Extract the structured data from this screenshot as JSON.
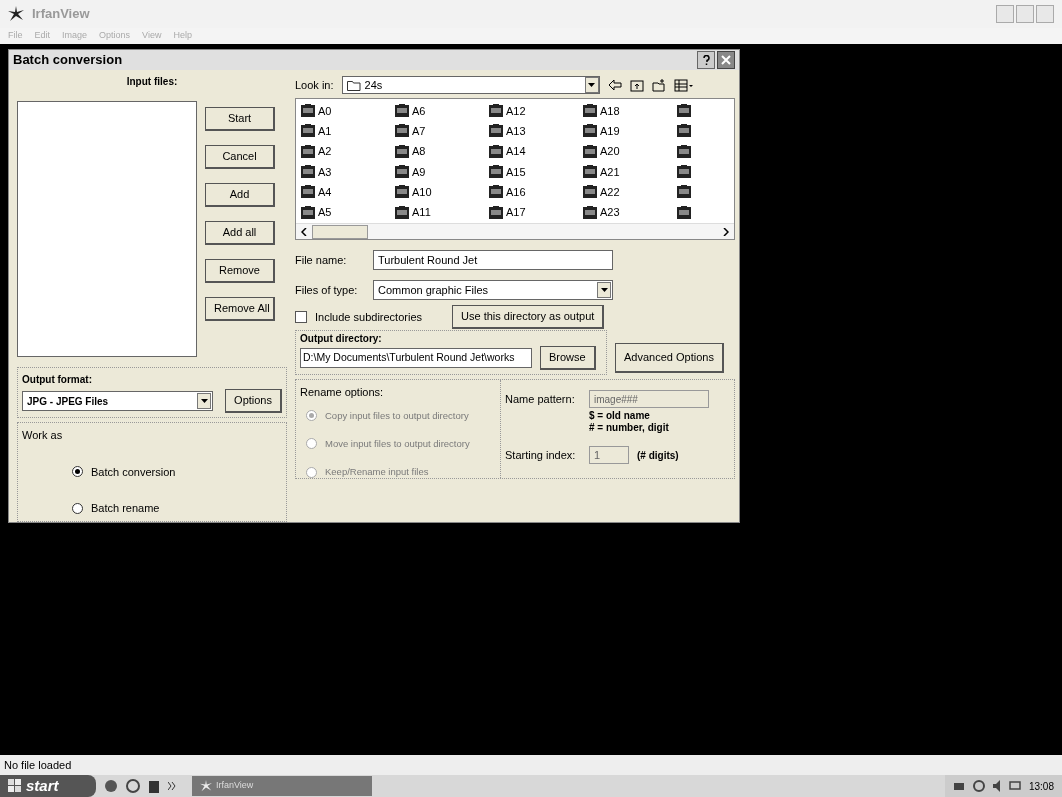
{
  "app": {
    "title": "IrfanView",
    "menu": [
      "File",
      "Edit",
      "Image",
      "Options",
      "View",
      "Help"
    ]
  },
  "dialog": {
    "title": "Batch conversion",
    "input_files": {
      "label": "Input files:"
    },
    "buttons": [
      "Start",
      "Cancel",
      "Add",
      "Add all",
      "Remove",
      "Remove All"
    ],
    "look_in": {
      "label": "Look in:",
      "value": "24s"
    },
    "files": [
      "A0",
      "A1",
      "A2",
      "A3",
      "A4",
      "A5",
      "A6",
      "A7",
      "A8",
      "A9",
      "A10",
      "A11",
      "A12",
      "A13",
      "A14",
      "A15",
      "A16",
      "A17",
      "A18",
      "A19",
      "A20",
      "A21",
      "A22",
      "A23"
    ],
    "file_name": {
      "label": "File name:",
      "value": "Turbulent Round Jet"
    },
    "files_of_type": {
      "label": "Files of type:",
      "value": "Common graphic Files"
    },
    "include_subdirectories": {
      "label": "Include subdirectories",
      "checked": false
    },
    "use_dir_button": "Use this directory as output",
    "output_format": {
      "label": "Output format:",
      "value": "JPG - JPEG Files",
      "button": "Options"
    },
    "output_directory": {
      "label": "Output directory:",
      "value": "D:\\My Documents\\Turbulent Round Jet\\works",
      "button": "Browse"
    },
    "advanced_button": "Advanced Options",
    "work_as": {
      "label": "Work as",
      "options": [
        {
          "label": "Batch conversion",
          "selected": true
        },
        {
          "label": "Batch rename",
          "selected": false
        }
      ]
    },
    "rename_options": {
      "label": "Rename options:",
      "disabled": true,
      "options": [
        {
          "label": "Copy input files to output directory",
          "selected": true
        },
        {
          "label": "Move input files to output directory",
          "selected": false
        },
        {
          "label": "Keep/Rename input files",
          "selected": false
        }
      ]
    },
    "name_pattern": {
      "label": "Name pattern:",
      "value": "image###",
      "help": [
        "$ = old name",
        "# = number, digit"
      ]
    },
    "starting_index": {
      "label": "Starting index:",
      "value": "1",
      "note": "(# digits)"
    }
  },
  "status_bar": "No file loaded",
  "taskbar": {
    "start": "start",
    "task": "IrfanView",
    "clock": "13:08"
  }
}
